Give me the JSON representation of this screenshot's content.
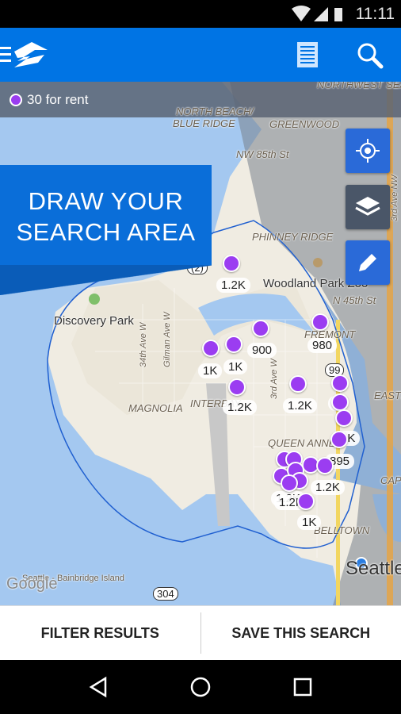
{
  "status_bar": {
    "time": "11:11",
    "icons": [
      "wifi-icon",
      "signal-icon",
      "battery-icon"
    ]
  },
  "app_bar": {
    "icons": [
      "menu-icon",
      "zillow-logo",
      "list-view-icon",
      "search-icon"
    ]
  },
  "filter": {
    "count_label": "30 for rent",
    "marker_color": "#9b3df1"
  },
  "banner": {
    "line1": "DRAW YOUR",
    "line2": "SEARCH AREA"
  },
  "map_controls": [
    "my-location-icon",
    "layers-icon",
    "draw-pencil-icon"
  ],
  "places": [
    "NORTHWEST SEATTLE",
    "NORTH BEACH/",
    "BLUE RIDGE",
    "GREENWOOD",
    "NW 85th St",
    "PHINNEY RIDGE",
    "Woodland Park Zoo",
    "N 45th St",
    "Discovery Park",
    "FREMONT",
    "MAGNOLIA",
    "INTERBAY",
    "QUEEN ANNE",
    "BELLTOWN",
    "EASTLAKE",
    "CAPITOL HILL",
    "Seattle - Bainbridge Island",
    "Seattle",
    "Gilman Ave W",
    "34th Ave W",
    "3rd Ave W",
    "3rd Ave NW",
    "99",
    "304",
    "(2)",
    "Google"
  ],
  "prices": [
    "1.2K",
    "900",
    "980",
    "1K",
    "1K",
    "1.2K",
    "1.2K",
    "895",
    "1.2K",
    "1.2K",
    "1.2K",
    "1K",
    "2K",
    "8"
  ],
  "colors": {
    "header": "#0074e4",
    "water": "#a4c8f0",
    "land": "#f0ece2",
    "banner": "#0a6ed9"
  },
  "bottom": {
    "filter_label": "FILTER RESULTS",
    "save_label": "SAVE THIS SEARCH"
  },
  "nav": [
    "back-icon",
    "home-icon",
    "recents-icon"
  ]
}
